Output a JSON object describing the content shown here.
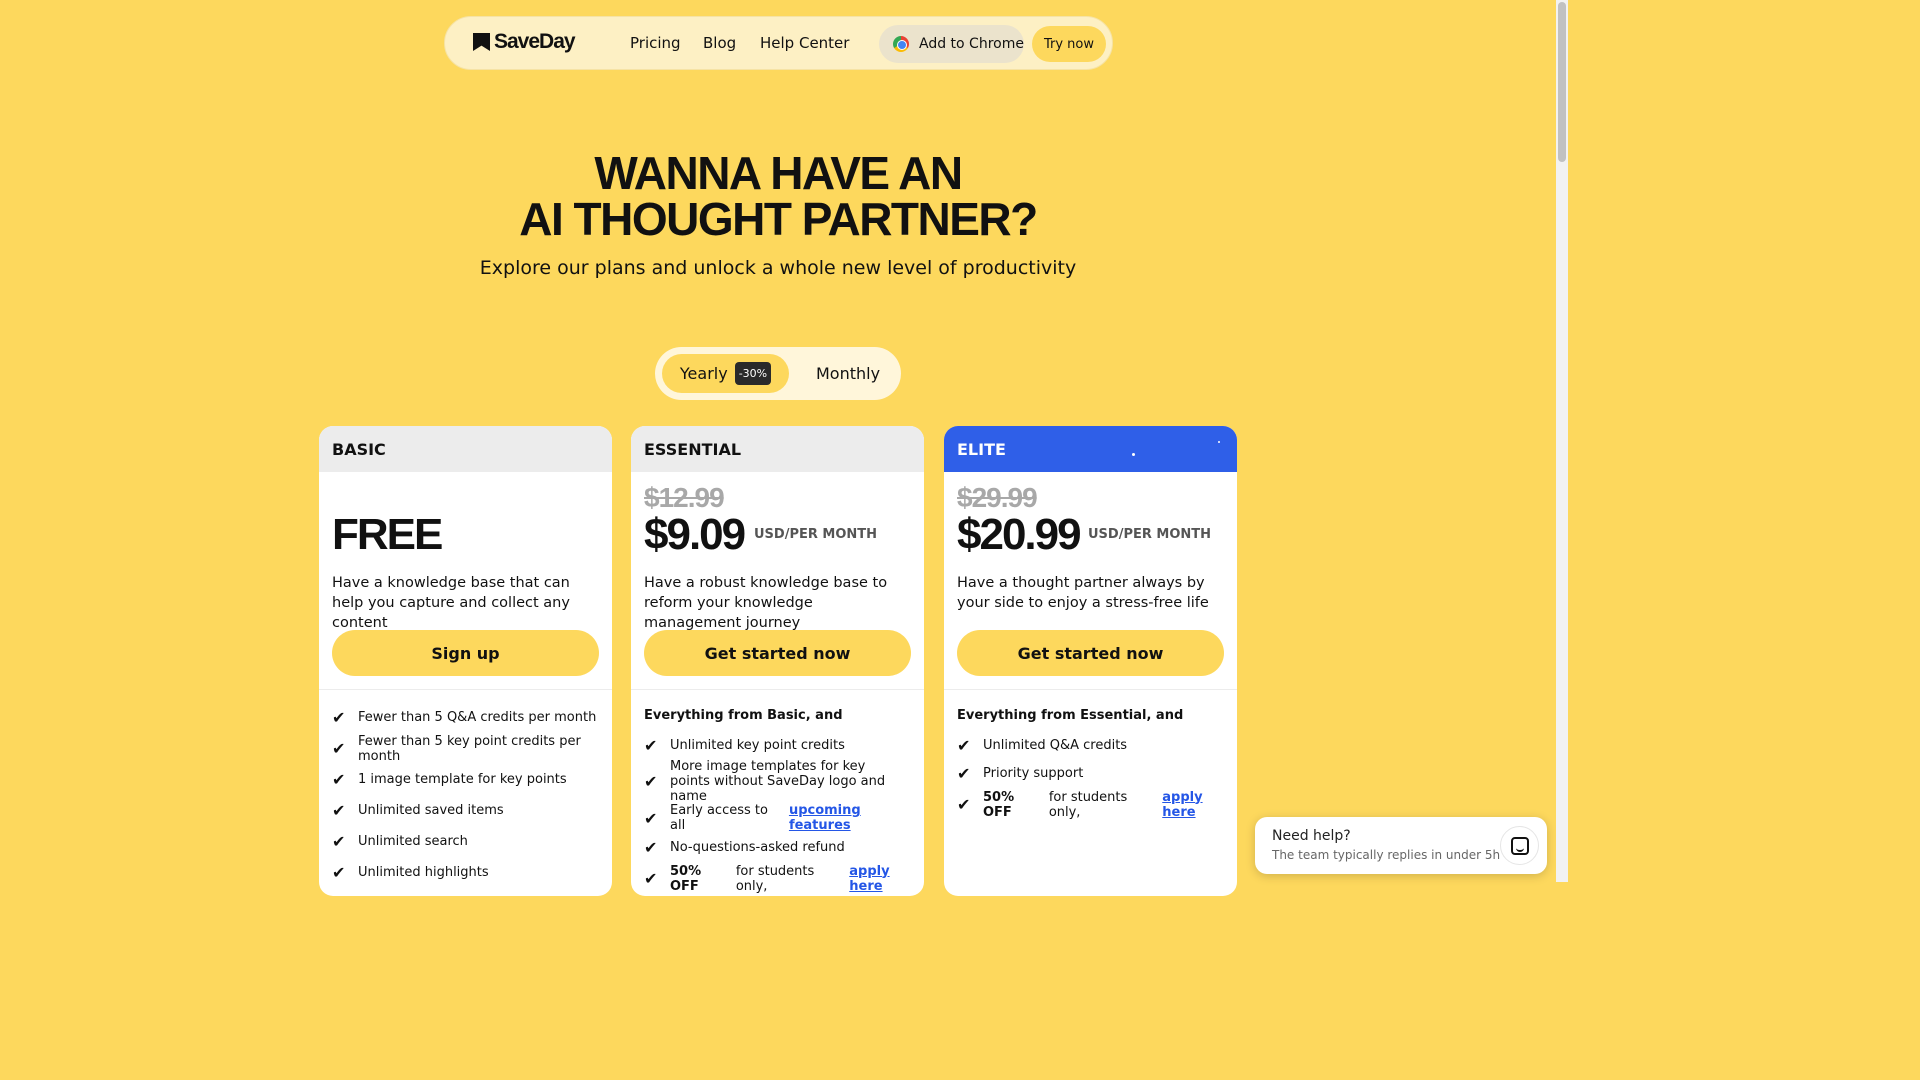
{
  "nav": {
    "logo": "SaveDay",
    "links": [
      "Pricing",
      "Blog",
      "Help Center"
    ],
    "add_chrome": "Add to Chrome",
    "try_now": "Try now"
  },
  "hero": {
    "title_line1": "WANNA HAVE AN",
    "title_line2": "AI THOUGHT PARTNER?",
    "subtitle": "Explore our plans and unlock a whole new level of productivity"
  },
  "billing_toggle": {
    "yearly": "Yearly",
    "discount_badge": "-30%",
    "monthly": "Monthly",
    "selected": "Yearly"
  },
  "plans": [
    {
      "name": "BASIC",
      "price": "FREE",
      "description": "Have a knowledge base that can help you capture and collect any content",
      "cta": "Sign up",
      "features": [
        "Fewer than 5 Q&A credits per month",
        "Fewer than 5 key point credits per month",
        "1 image template for key points",
        "Unlimited saved items",
        "Unlimited search",
        "Unlimited highlights"
      ]
    },
    {
      "name": "ESSENTIAL",
      "old_price": "$12.99",
      "price": "$9.09",
      "unit": "USD/PER MONTH",
      "description": "Have a robust knowledge base to reform your knowledge management journey",
      "cta": "Get started now",
      "features_heading": "Everything from Basic, and",
      "features": [
        "Unlimited key point credits",
        "More image templates for key points without SaveDay logo and name",
        "Early access to all",
        "No-questions-asked refund",
        "50% OFF"
      ],
      "feature_link": "upcoming features",
      "student_text": "for students only,",
      "student_link": "apply here"
    },
    {
      "name": "ELITE",
      "old_price": "$29.99",
      "price": "$20.99",
      "unit": "USD/PER MONTH",
      "description": "Have a thought partner always by your side to enjoy a stress-free life",
      "cta": "Get started now",
      "features_heading": "Everything from Essential, and",
      "features": [
        "Unlimited Q&A credits",
        "Priority support",
        "50% OFF"
      ],
      "student_text": "for students only,",
      "student_link": "apply here"
    }
  ],
  "help_widget": {
    "title": "Need help?",
    "subtitle": "The team typically replies in under 5h"
  },
  "colors": {
    "background": "#fdd85d",
    "elite_header": "#2f5fe8",
    "link": "#2456e6"
  }
}
